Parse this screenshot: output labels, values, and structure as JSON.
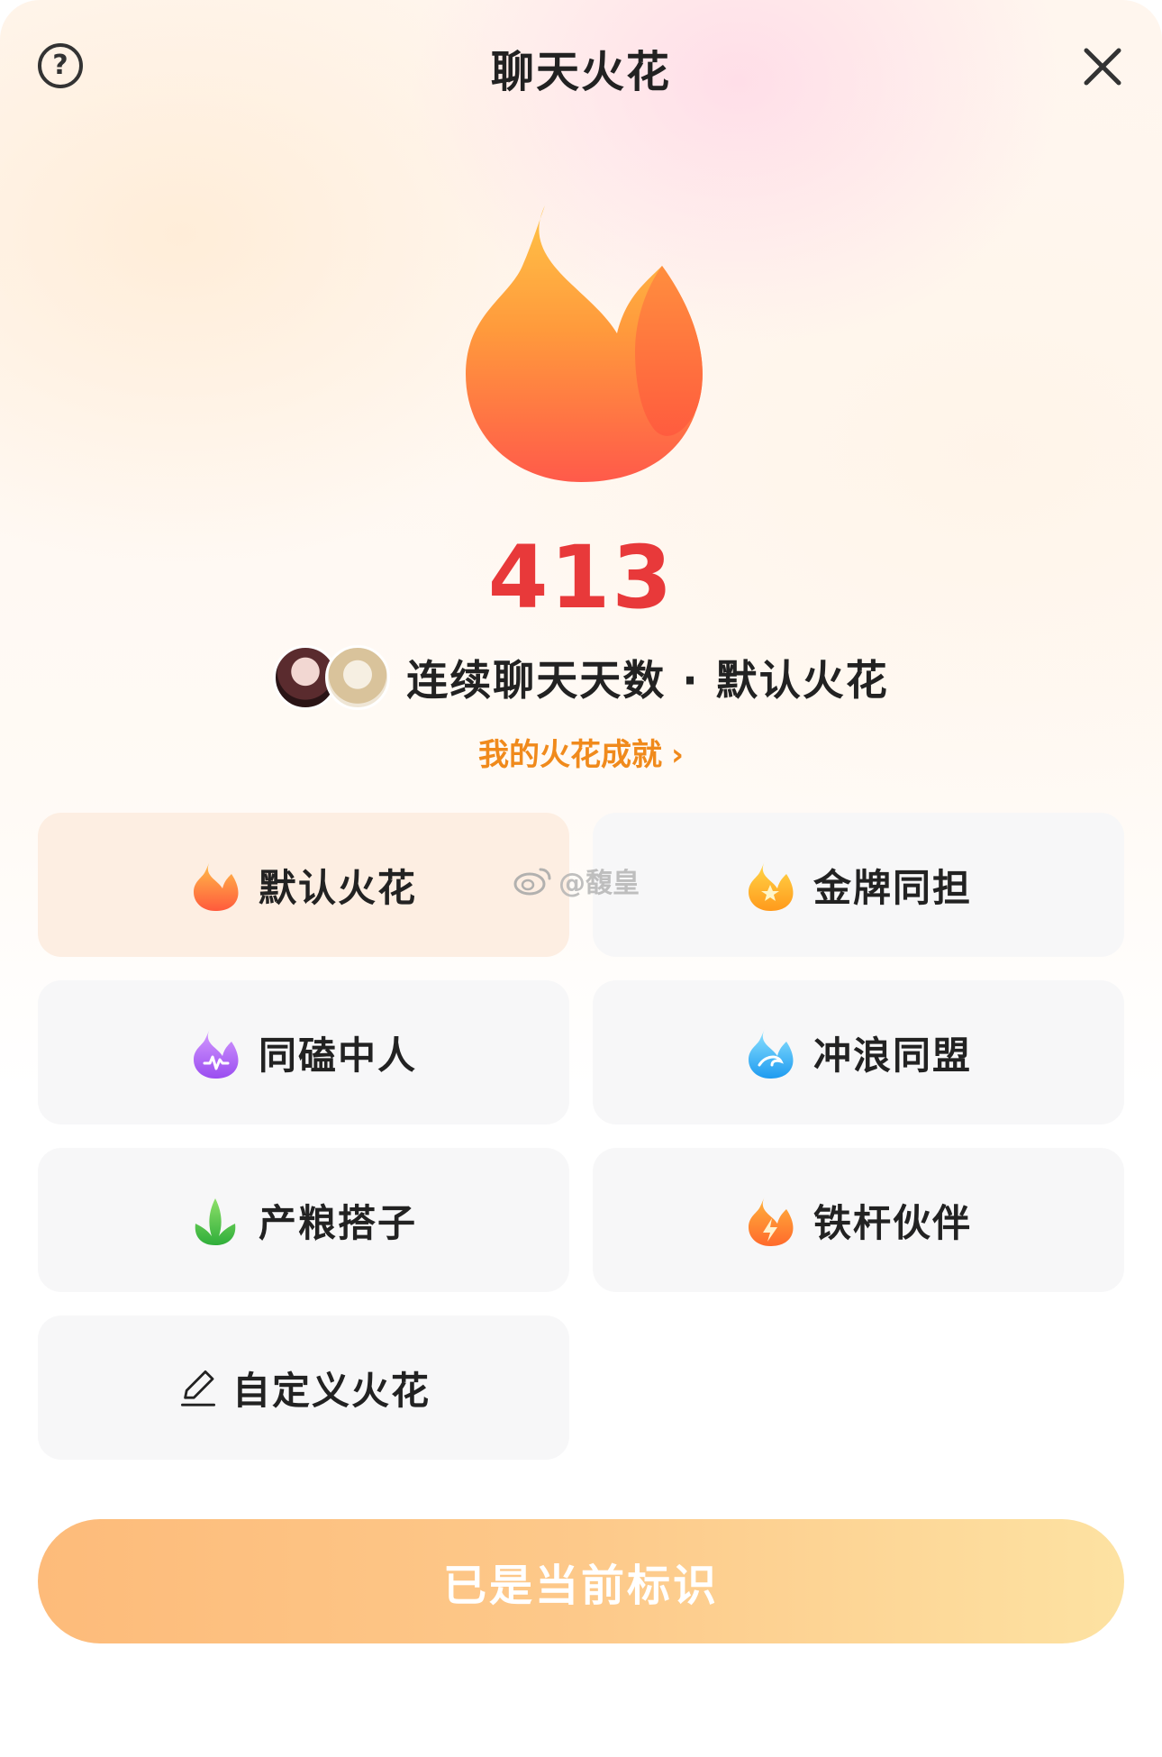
{
  "header": {
    "title": "聊天火花",
    "help_glyph": "?",
    "help_icon": "question-circle-icon",
    "close_icon": "close-icon"
  },
  "hero": {
    "icon": "flame-icon",
    "days_count": "413",
    "streak_text": "连续聊天天数 · 默认火花",
    "achievements_link": "我的火花成就",
    "achievements_chevron": "›"
  },
  "spark_types": [
    {
      "label": "默认火花",
      "icon": "flame-orange-icon",
      "selected": true
    },
    {
      "label": "金牌同担",
      "icon": "flame-gold-star-icon",
      "selected": false
    },
    {
      "label": "同磕中人",
      "icon": "flame-purple-icon",
      "selected": false
    },
    {
      "label": "冲浪同盟",
      "icon": "flame-wave-blue-icon",
      "selected": false
    },
    {
      "label": "产粮搭子",
      "icon": "leaf-green-icon",
      "selected": false
    },
    {
      "label": "铁杆伙伴",
      "icon": "flame-lightning-icon",
      "selected": false
    },
    {
      "label": "自定义火花",
      "icon": "pencil-icon",
      "selected": false
    }
  ],
  "watermark": "@馥皇",
  "footer": {
    "button_label": "已是当前标识"
  },
  "colors": {
    "count_red": "#e8393a",
    "achievement_orange": "#f08a1c",
    "selected_bg": "#fdeee2",
    "button_gradient_start": "#fdbb7a",
    "button_gradient_end": "#fde2a2"
  }
}
